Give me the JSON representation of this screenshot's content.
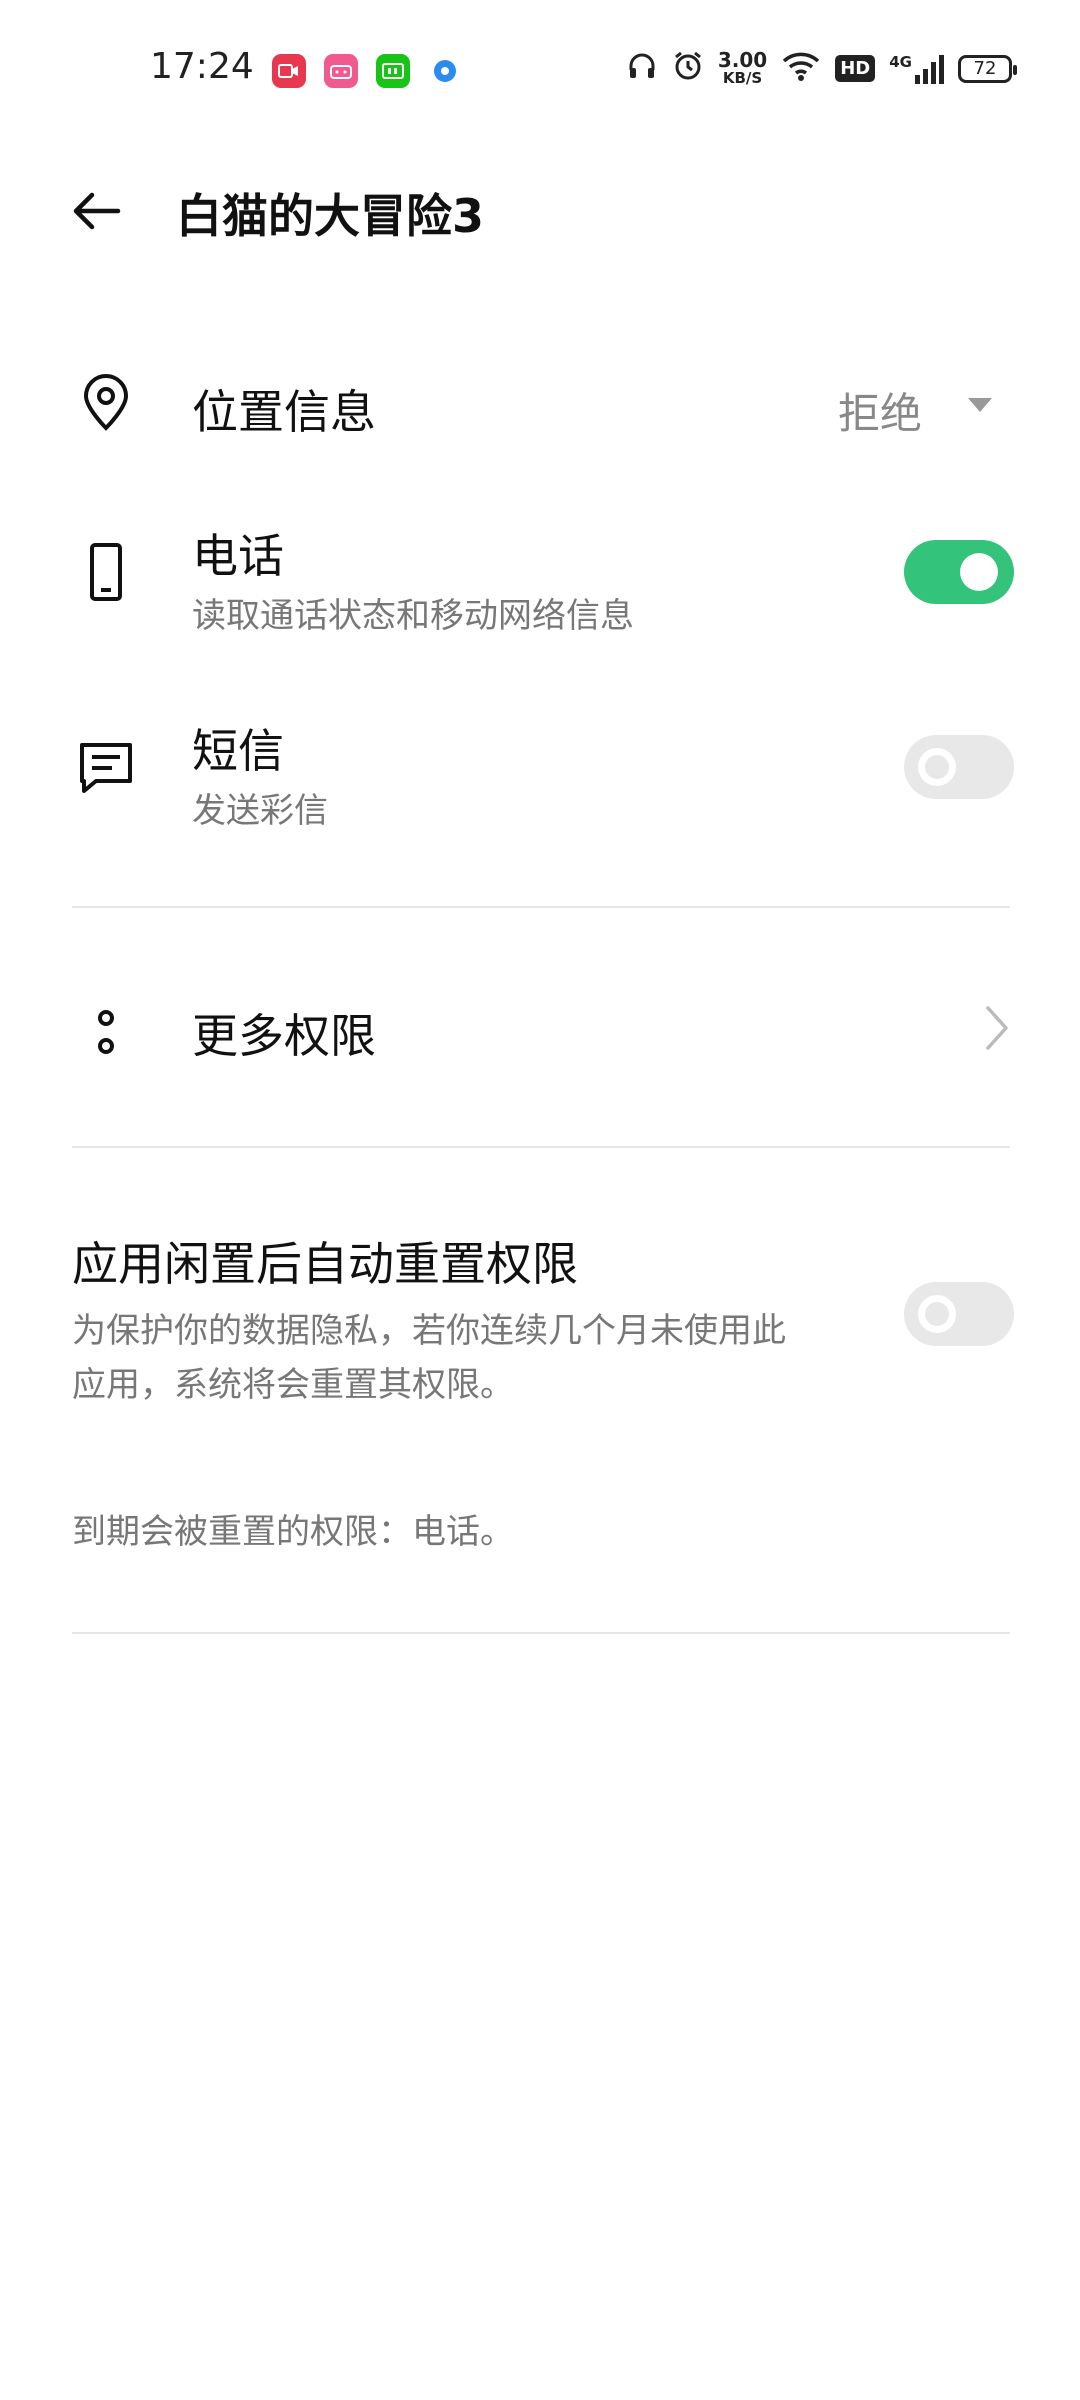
{
  "status_bar": {
    "time": "17:24",
    "network_speed_value": "3.00",
    "network_speed_unit": "KB/S",
    "hd_label": "HD",
    "network_type": "4G",
    "battery_level": "72"
  },
  "header": {
    "title": "白猫的大冒险3"
  },
  "permissions": {
    "location": {
      "label": "位置信息",
      "value": "拒绝"
    },
    "phone": {
      "label": "电话",
      "description": "读取通话状态和移动网络信息",
      "enabled": true
    },
    "sms": {
      "label": "短信",
      "description": "发送彩信",
      "enabled": false
    },
    "more": {
      "label": "更多权限"
    }
  },
  "auto_reset": {
    "title": "应用闲置后自动重置权限",
    "description_line1": "为保护你的数据隐私，若你连续几个月未使用此",
    "description_line2": "应用，系统将会重置其权限。",
    "enabled": false,
    "expiring_note": "到期会被重置的权限：电话。"
  },
  "colors": {
    "accent": "#33c37a",
    "toggle_off": "#e8e8e8",
    "secondary_text": "#777777"
  }
}
